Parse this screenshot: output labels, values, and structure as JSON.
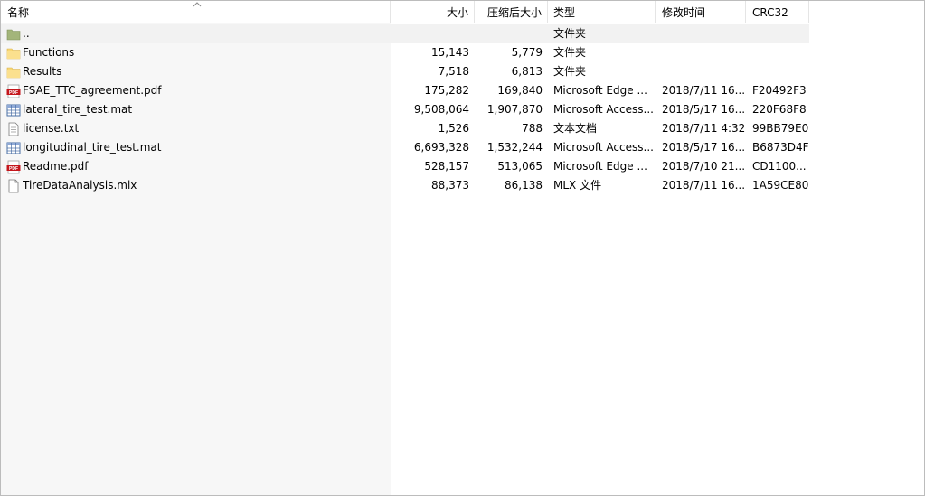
{
  "header": {
    "name": "名称",
    "size": "大小",
    "packed": "压缩后大小",
    "type": "类型",
    "modified": "修改时间",
    "crc": "CRC32"
  },
  "colors": {
    "folder": "#f8d775",
    "parent_folder": "#a3b57a",
    "pdf_red": "#c4161c",
    "grid_blue": "#4a6fa5",
    "name_column_bg": "#f7f7f7"
  },
  "rows": [
    {
      "icon": "parent-folder-icon",
      "name": "..",
      "size": "",
      "packed": "",
      "type": "文件夹",
      "modified": "",
      "crc": ""
    },
    {
      "icon": "folder-icon",
      "name": "Functions",
      "size": "15,143",
      "packed": "5,779",
      "type": "文件夹",
      "modified": "",
      "crc": ""
    },
    {
      "icon": "folder-icon",
      "name": "Results",
      "size": "7,518",
      "packed": "6,813",
      "type": "文件夹",
      "modified": "",
      "crc": ""
    },
    {
      "icon": "pdf-icon",
      "name": "FSAE_TTC_agreement.pdf",
      "size": "175,282",
      "packed": "169,840",
      "type": "Microsoft Edge ...",
      "modified": "2018/7/11 16...",
      "crc": "F20492F3"
    },
    {
      "icon": "table-icon",
      "name": "lateral_tire_test.mat",
      "size": "9,508,064",
      "packed": "1,907,870",
      "type": "Microsoft Access...",
      "modified": "2018/5/17 16...",
      "crc": "220F68F8"
    },
    {
      "icon": "text-file-icon",
      "name": "license.txt",
      "size": "1,526",
      "packed": "788",
      "type": "文本文档",
      "modified": "2018/7/11 4:32",
      "crc": "99BB79E0"
    },
    {
      "icon": "table-icon",
      "name": "longitudinal_tire_test.mat",
      "size": "6,693,328",
      "packed": "1,532,244",
      "type": "Microsoft Access...",
      "modified": "2018/5/17 16...",
      "crc": "B6873D4F"
    },
    {
      "icon": "pdf-icon",
      "name": "Readme.pdf",
      "size": "528,157",
      "packed": "513,065",
      "type": "Microsoft Edge ...",
      "modified": "2018/7/10 21...",
      "crc": "CD1100..."
    },
    {
      "icon": "blank-file-icon",
      "name": "TireDataAnalysis.mlx",
      "size": "88,373",
      "packed": "86,138",
      "type": "MLX 文件",
      "modified": "2018/7/11 16...",
      "crc": "1A59CE80"
    }
  ]
}
